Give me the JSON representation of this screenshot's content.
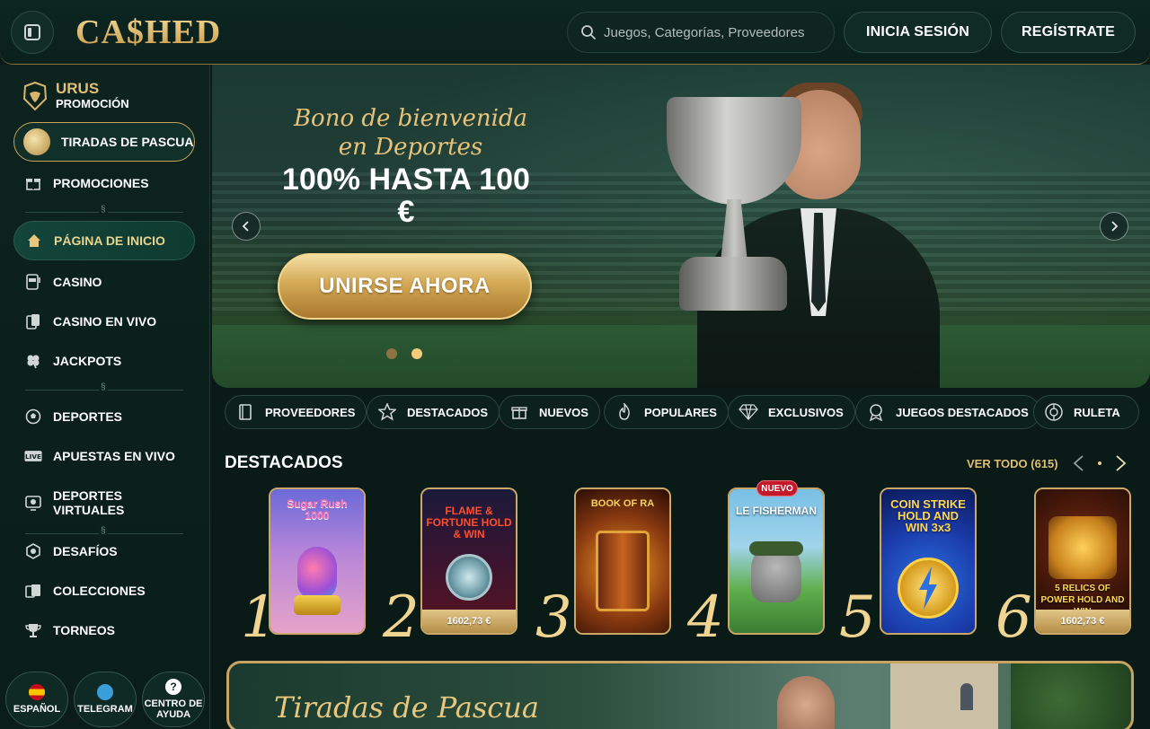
{
  "header": {
    "logo_text": "CA$HED",
    "search_placeholder": "Juegos, Categorías, Proveedores",
    "login_label": "INICIA SESIÓN",
    "register_label": "REGÍSTRATE"
  },
  "sidebar": {
    "promo_title": "URUS",
    "promo_subtitle": "PROMOCIÓN",
    "pascua_label": "TIRADAS DE PASCUA",
    "items": [
      {
        "label": "PROMOCIONES",
        "icon": "gift-icon"
      },
      {
        "label": "PÁGINA DE INICIO",
        "icon": "home-icon",
        "active": true
      },
      {
        "label": "CASINO",
        "icon": "slot-machine-icon"
      },
      {
        "label": "CASINO EN VIVO",
        "icon": "live-cards-icon"
      },
      {
        "label": "JACKPOTS",
        "icon": "clover-icon"
      },
      {
        "label": "DEPORTES",
        "icon": "soccer-ball-icon"
      },
      {
        "label": "APUESTAS EN VIVO",
        "icon": "live-badge-icon"
      },
      {
        "label": "DEPORTES VIRTUALES",
        "icon": "virtual-sports-icon"
      },
      {
        "label": "DESAFÍOS",
        "icon": "challenge-badge-icon"
      },
      {
        "label": "COLECCIONES",
        "icon": "collections-icon"
      },
      {
        "label": "TORNEOS",
        "icon": "trophy-icon"
      }
    ],
    "bottom": [
      {
        "label": "ESPAÑOL",
        "icon": "spain-flag-icon"
      },
      {
        "label": "TELEGRAM",
        "icon": "telegram-icon"
      },
      {
        "label": "CENTRO DE AYUDA",
        "icon": "help-icon"
      }
    ]
  },
  "hero": {
    "welcome": "Bono de bienvenida en Deportes",
    "amount": "100% HASTA 100 €",
    "cta": "UNIRSE AHORA",
    "slides_total": 2,
    "slide_active": 2
  },
  "categories": [
    {
      "label": "PROVEEDORES",
      "icon": "book-icon"
    },
    {
      "label": "DESTACADOS",
      "icon": "star-icon"
    },
    {
      "label": "NUEVOS",
      "icon": "gift-box-icon"
    },
    {
      "label": "POPULARES",
      "icon": "flame-icon"
    },
    {
      "label": "EXCLUSIVOS",
      "icon": "diamond-icon"
    },
    {
      "label": "JUEGOS DESTACADOS",
      "icon": "medal-icon"
    },
    {
      "label": "RULETA",
      "icon": "roulette-icon"
    }
  ],
  "featured": {
    "title": "DESTACADOS",
    "view_all": "VER TODO (615)",
    "games": [
      {
        "rank": "1",
        "name": "Sugar Rush 1000",
        "price": "",
        "badge": ""
      },
      {
        "rank": "2",
        "name": "FLAME & FORTUNE HOLD & WIN",
        "price": "1602,73 €",
        "badge": ""
      },
      {
        "rank": "3",
        "name": "BOOK OF RA",
        "price": "",
        "badge": ""
      },
      {
        "rank": "4",
        "name": "LE FISHERMAN",
        "price": "",
        "badge": "NUEVO"
      },
      {
        "rank": "5",
        "name": "COIN STRIKE HOLD AND WIN 3x3",
        "price": "",
        "badge": ""
      },
      {
        "rank": "6",
        "name": "5 RELICS OF POWER HOLD AND WIN",
        "price": "1602,73 €",
        "badge": ""
      }
    ]
  },
  "promo_banner": {
    "title": "Tiradas de Pascua"
  },
  "colors": {
    "gold": "#e0be74",
    "bg": "#0a1a16",
    "accent_green": "#14453a",
    "badge_red": "#c4182b"
  }
}
